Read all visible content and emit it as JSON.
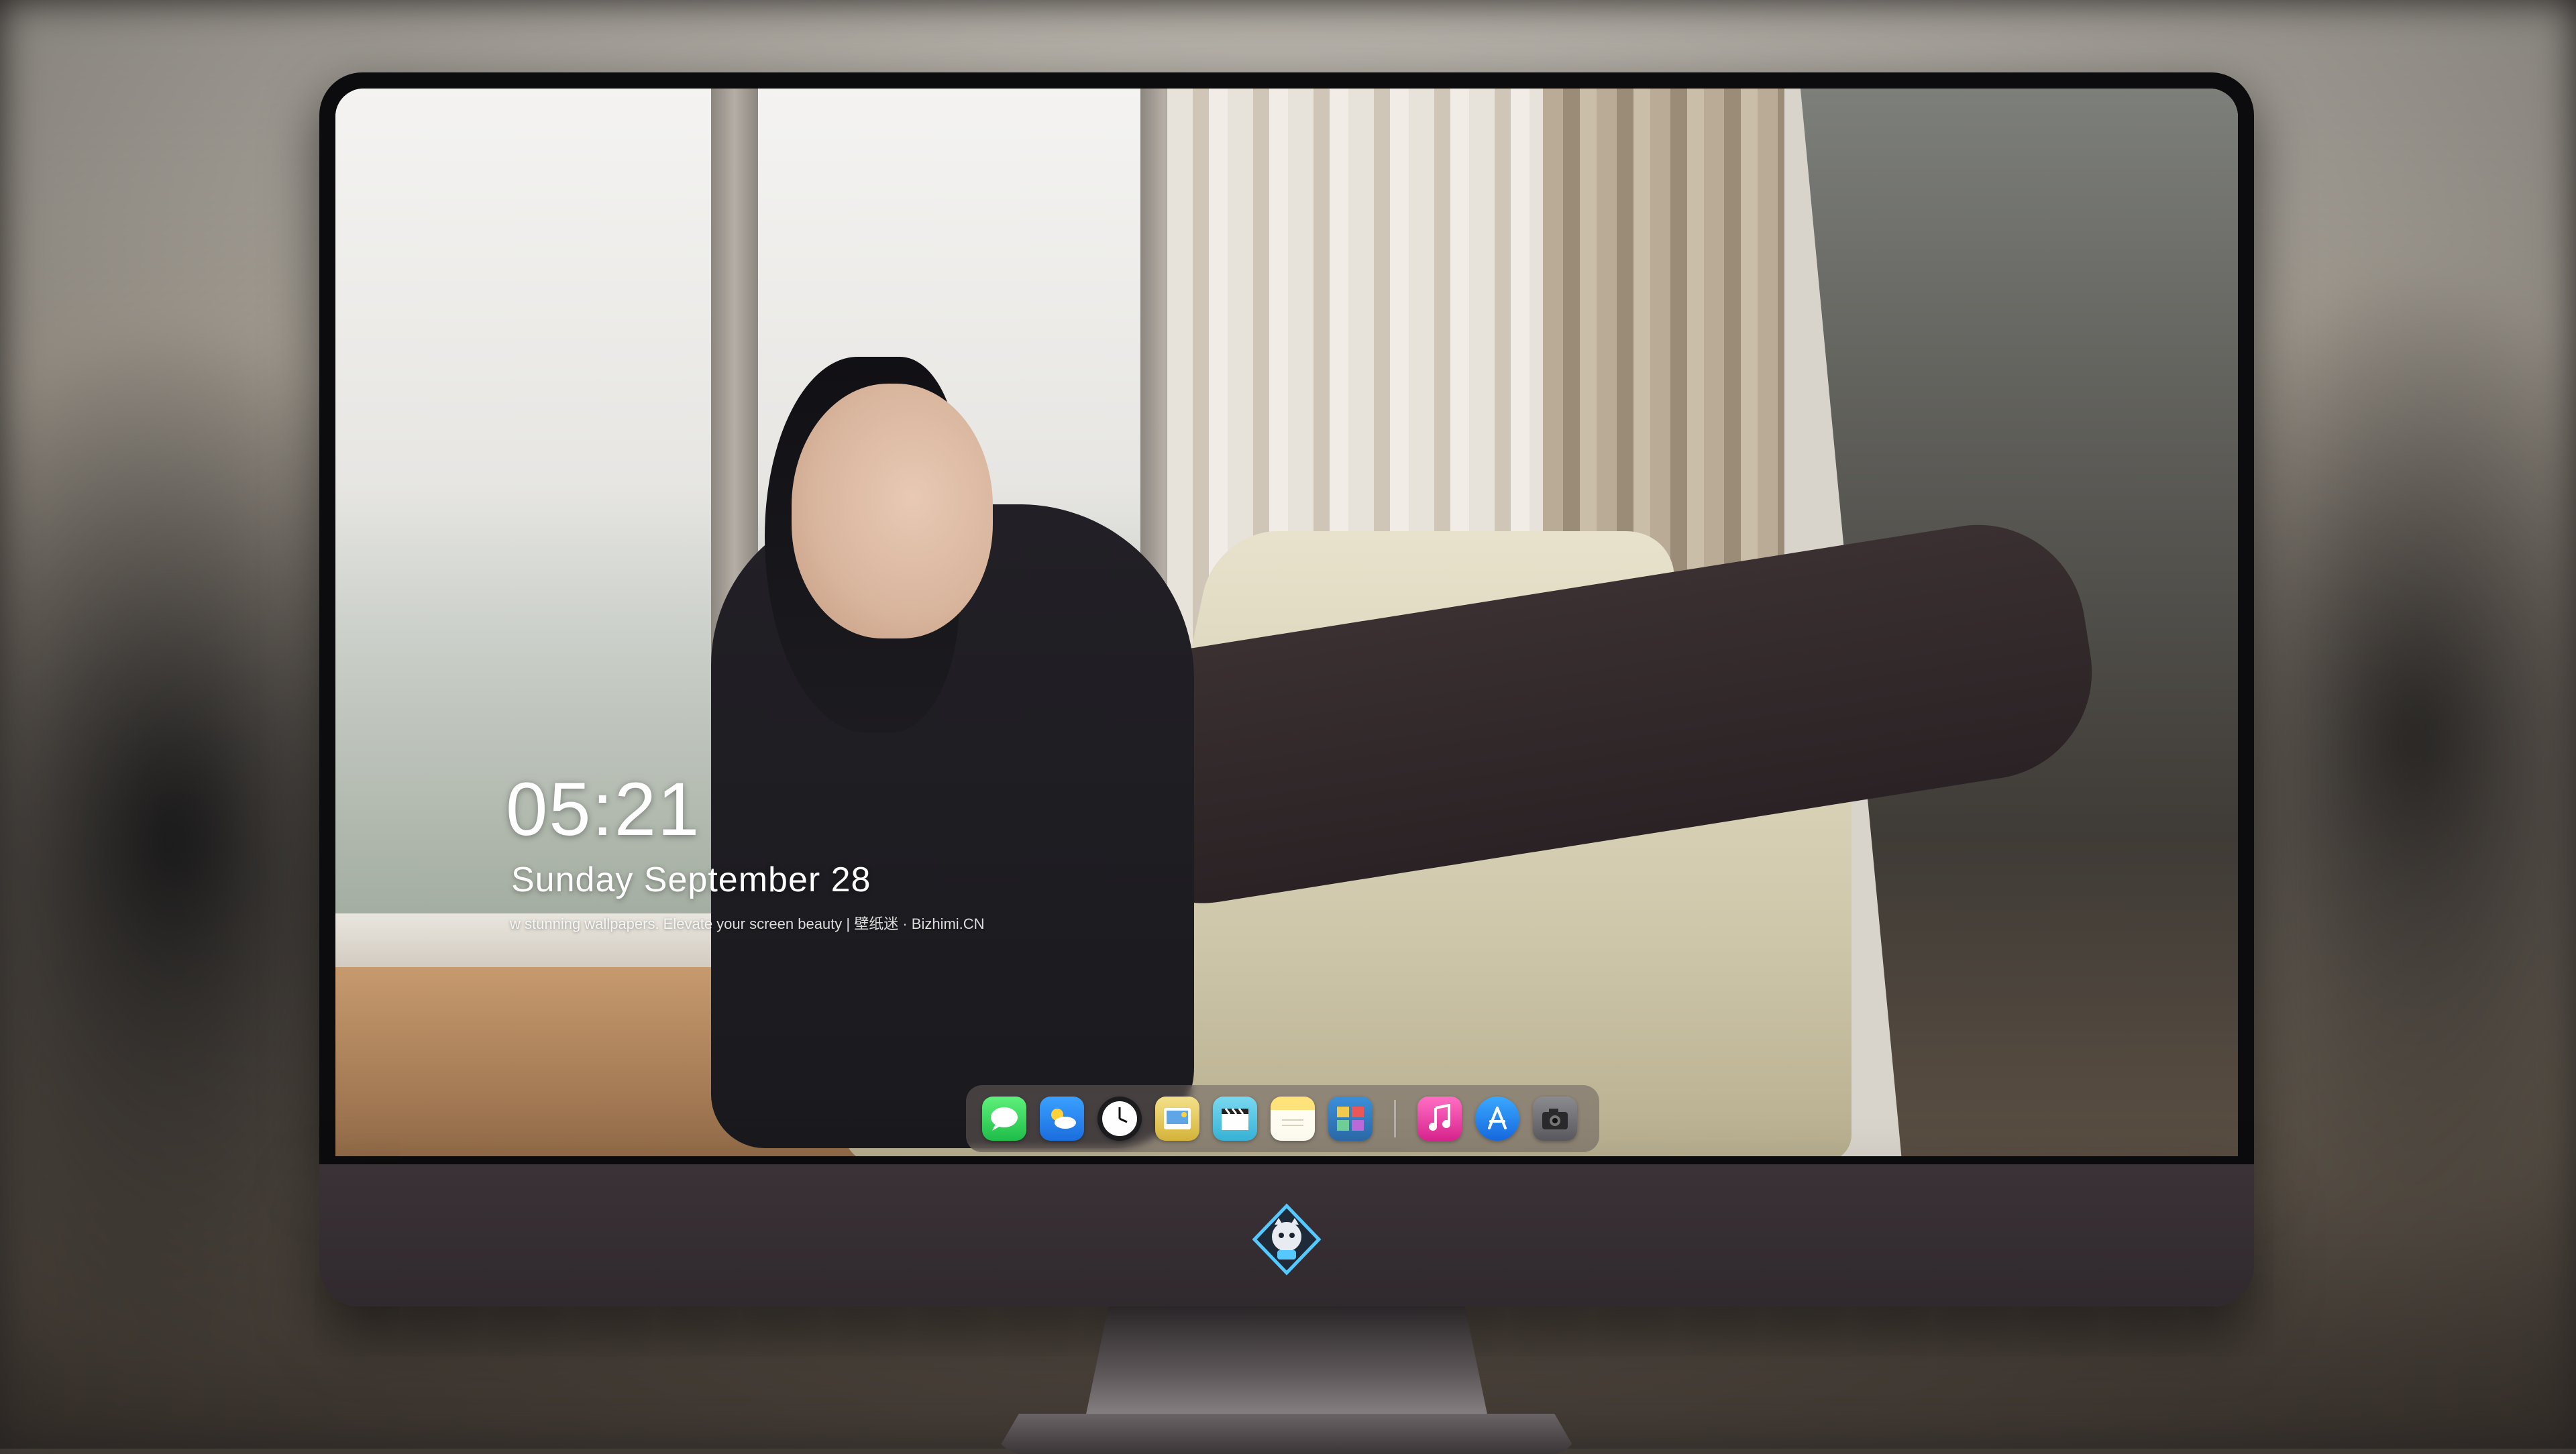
{
  "clock": {
    "time": "05:21",
    "date": "Sunday September  28",
    "tagline": "w stunning wallpapers. Elevate your screen beauty | 壁纸迷 · Bizhimi.CN"
  },
  "dock": {
    "apps": [
      {
        "name": "messages-icon",
        "color": "#30d158"
      },
      {
        "name": "weather-icon",
        "color": "#1e90ff"
      },
      {
        "name": "clock-icon",
        "color": "#1c1c1e"
      },
      {
        "name": "preview-icon",
        "color": "#e6c850"
      },
      {
        "name": "clapperboard-icon",
        "color": "#5ec8e6"
      },
      {
        "name": "notes-icon",
        "color": "#ffd65a"
      },
      {
        "name": "photo-booth-icon",
        "color": "#4a9e5a"
      },
      {
        "name": "music-icon",
        "color": "#ff3ea5"
      },
      {
        "name": "app-store-icon",
        "color": "#1e8cff"
      },
      {
        "name": "camera-icon",
        "color": "#6e6e73"
      }
    ]
  },
  "colors": {
    "chin": "#342d31",
    "bezel": "#0c0c0e",
    "dock_bg": "#695f5c"
  }
}
